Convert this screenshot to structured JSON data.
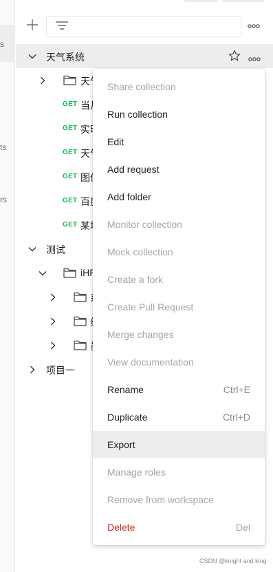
{
  "left_strip": [
    "s",
    "ts",
    "rs"
  ],
  "tree": {
    "rows": [
      {
        "kind": "collection",
        "label": "天气系统",
        "chevron": "down"
      },
      {
        "kind": "folder",
        "label": "天气",
        "chevron": "right"
      },
      {
        "kind": "request",
        "method": "GET",
        "label": "当月"
      },
      {
        "kind": "request",
        "method": "GET",
        "label": "实时"
      },
      {
        "kind": "request",
        "method": "GET",
        "label": "天气"
      },
      {
        "kind": "request",
        "method": "GET",
        "label": "图像"
      },
      {
        "kind": "request",
        "method": "GET",
        "label": "百度"
      },
      {
        "kind": "request",
        "method": "GET",
        "label": "某地"
      },
      {
        "kind": "collection",
        "label": "测试",
        "chevron": "down"
      },
      {
        "kind": "folder",
        "label": "iHRM",
        "chevron": "down"
      },
      {
        "kind": "folder",
        "label": "系",
        "chevron": "right"
      },
      {
        "kind": "folder",
        "label": "组",
        "chevron": "right"
      },
      {
        "kind": "folder",
        "label": "员",
        "chevron": "right"
      },
      {
        "kind": "collection",
        "label": "项目一",
        "chevron": "right"
      }
    ]
  },
  "menu": {
    "items": [
      {
        "label": "Share collection",
        "shortcut": "",
        "state": "disabled"
      },
      {
        "label": "Run collection",
        "shortcut": "",
        "state": "normal"
      },
      {
        "label": "Edit",
        "shortcut": "",
        "state": "normal"
      },
      {
        "label": "Add request",
        "shortcut": "",
        "state": "normal"
      },
      {
        "label": "Add folder",
        "shortcut": "",
        "state": "normal"
      },
      {
        "label": "Monitor collection",
        "shortcut": "",
        "state": "disabled"
      },
      {
        "label": "Mock collection",
        "shortcut": "",
        "state": "disabled"
      },
      {
        "label": "Create a fork",
        "shortcut": "",
        "state": "disabled"
      },
      {
        "label": "Create Pull Request",
        "shortcut": "",
        "state": "disabled"
      },
      {
        "label": "Merge changes",
        "shortcut": "",
        "state": "disabled"
      },
      {
        "label": "View documentation",
        "shortcut": "",
        "state": "disabled"
      },
      {
        "label": "Rename",
        "shortcut": "Ctrl+E",
        "state": "normal"
      },
      {
        "label": "Duplicate",
        "shortcut": "Ctrl+D",
        "state": "normal"
      },
      {
        "label": "Export",
        "shortcut": "",
        "state": "hover"
      },
      {
        "label": "Manage roles",
        "shortcut": "",
        "state": "disabled"
      },
      {
        "label": "Remove from workspace",
        "shortcut": "",
        "state": "disabled"
      },
      {
        "label": "Delete",
        "shortcut": "Del",
        "state": "danger"
      }
    ]
  },
  "icons": {
    "add": "plus-icon",
    "filter": "filter-icon",
    "more": "more-horizontal-icon",
    "star": "star-outline-icon",
    "folder": "folder-icon",
    "chevron_down": "chevron-down-icon",
    "chevron_right": "chevron-right-icon"
  },
  "colors": {
    "get_method": "#0cbb52",
    "danger": "#d02a1e",
    "disabled_text": "#a6a6a6",
    "hover_bg": "#ededed"
  },
  "watermark": "CSDN @knight and king"
}
